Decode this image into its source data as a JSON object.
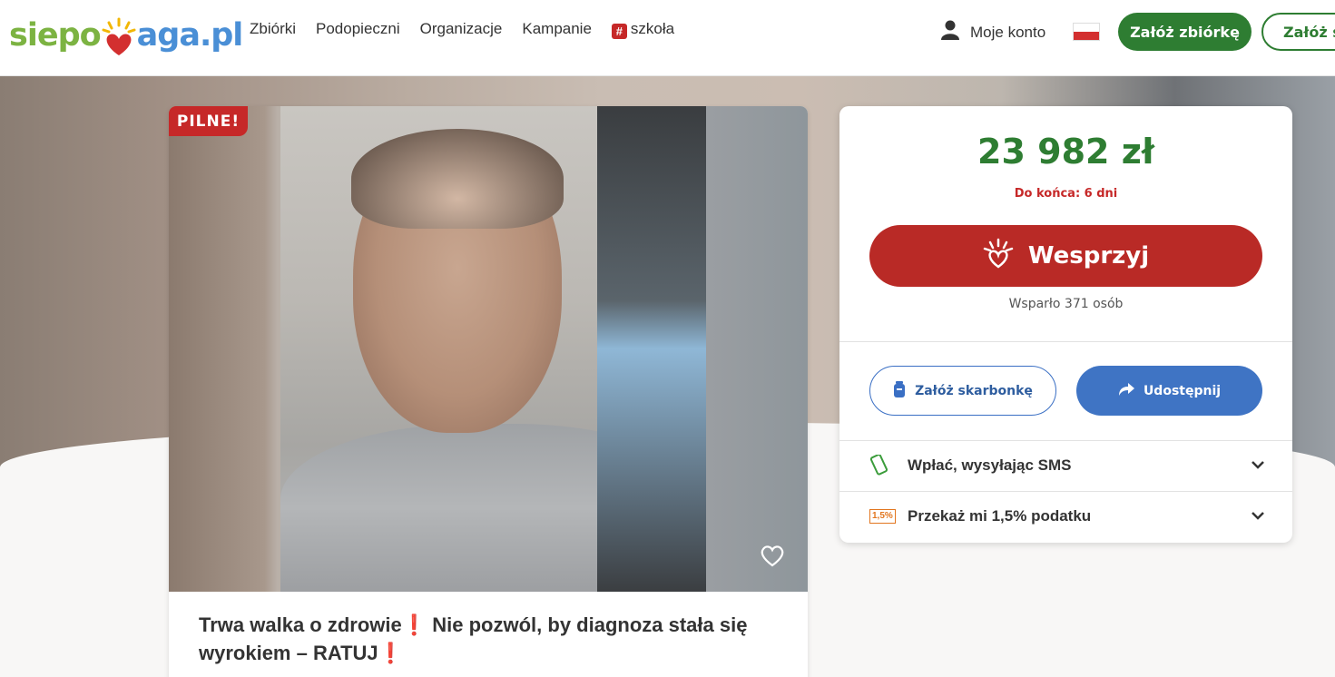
{
  "header": {
    "logo_part1": "siepo",
    "logo_part2": "aga.pl",
    "nav": [
      "Zbiórki",
      "Podopieczni",
      "Organizacje",
      "Kampanie"
    ],
    "school_label": "szkoła",
    "account_label": "Moje konto",
    "create_label": "Załóż zbiórkę",
    "create2_label": "Załóż su"
  },
  "campaign": {
    "badge": "PILNE!",
    "title_part1": "Trwa walka o zdrowie",
    "title_part2": " Nie pozwól, by diagnoza stała się wyrokiem – RATUJ",
    "excl": "❗"
  },
  "panel": {
    "amount": "23 982 zł",
    "deadline": "Do końca: 6 dni",
    "support_label": "Wesprzyj",
    "supporters": "Wsparło 371 osób",
    "piggy_label": "Załóż skarbonkę",
    "share_label": "Udostępnij",
    "sms_label": "Wpłać, wysyłając SMS",
    "tax_label": "Przekaż mi 1,5% podatku",
    "tax_icon_text": "1,5%"
  },
  "colors": {
    "brand_green": "#2e7d32",
    "support_red": "#b92a26",
    "share_blue": "#3f74c4",
    "urgent_red": "#c62828"
  }
}
